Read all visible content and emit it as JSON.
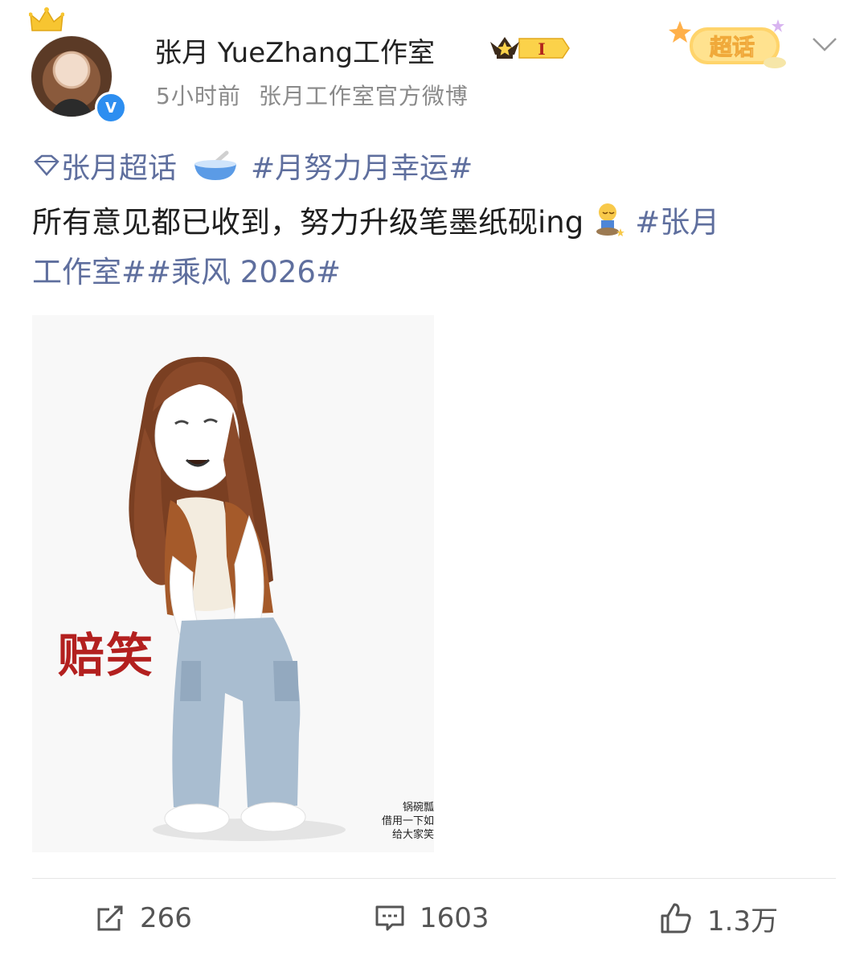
{
  "post": {
    "username": "张月 YueZhang工作室",
    "level_label": "I",
    "time": "5小时前",
    "source": "张月工作室官方微博",
    "supertopic_badge": "超话",
    "topic_label": "张月超话",
    "hashtag1": "#月努力月幸运#",
    "text_main": "所有意见都已收到，努力升级笔墨纸砚ing",
    "hashtag2_part1": "#张月",
    "hashtag2_part2": "工作室#",
    "hashtag3": "#乘风 2026#",
    "image": {
      "caption": "赔笑",
      "watermark_lines": [
        "锅碗瓢",
        "借用一下如",
        "给大家笑"
      ]
    }
  },
  "actions": {
    "repost_count": "266",
    "comment_count": "1603",
    "like_count": "1.3万"
  },
  "colors": {
    "link": "#5f6f9e",
    "verified": "#2d8ef0",
    "caption_red": "#b3201f"
  },
  "icons": [
    "crown-icon",
    "verified-icon",
    "level-badge-icon",
    "supertopic-badge-icon",
    "chevron-down-icon",
    "diamond-icon",
    "bowl-emoji-icon",
    "sitting-emoji-icon",
    "repost-icon",
    "comment-icon",
    "like-icon"
  ]
}
